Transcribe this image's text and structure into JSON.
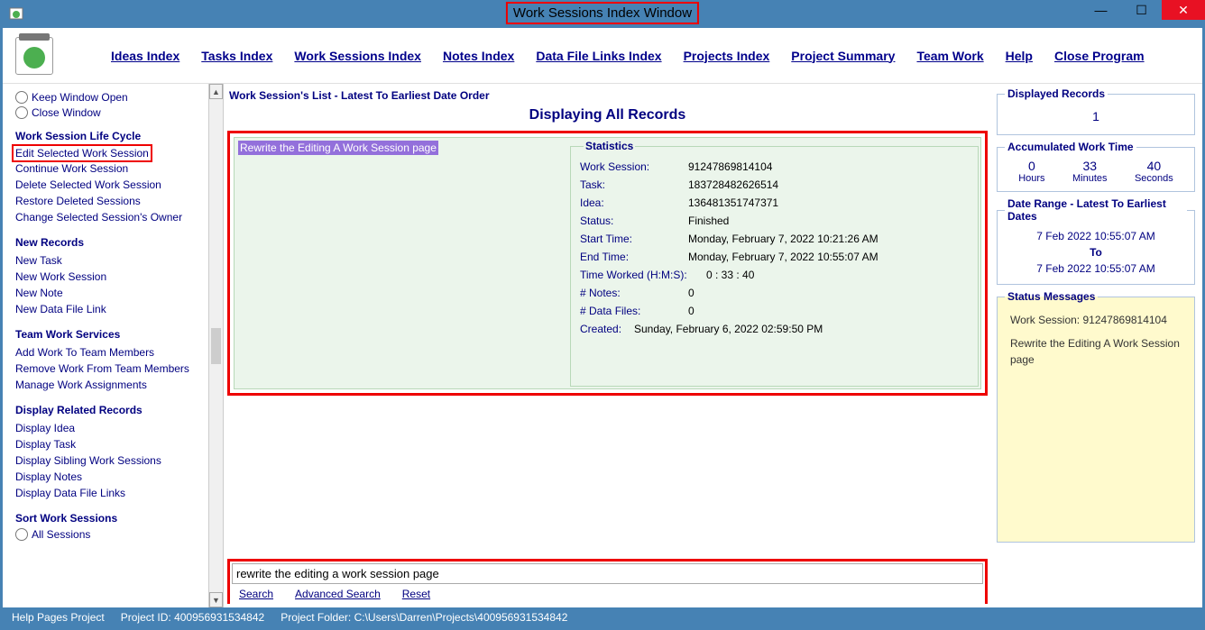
{
  "title": "Work Sessions Index Window",
  "menu": {
    "ideas": "Ideas Index",
    "tasks": "Tasks Index",
    "work_sessions": "Work Sessions Index",
    "notes": "Notes Index",
    "data_links": "Data File Links Index",
    "projects": "Projects Index",
    "summary": "Project Summary",
    "team": "Team Work",
    "help": "Help",
    "close": "Close Program"
  },
  "sidebar": {
    "keep_open": "Keep Window Open",
    "close_window": "Close Window",
    "lifecycle_title": "Work Session Life Cycle",
    "lifecycle": {
      "edit": "Edit Selected Work Session",
      "continue": "Continue Work Session",
      "delete": "Delete Selected Work Session",
      "restore": "Restore Deleted Sessions",
      "change_owner": "Change Selected Session's Owner"
    },
    "new_title": "New Records",
    "newrec": {
      "task": "New Task",
      "work": "New Work Session",
      "note": "New Note",
      "datalink": "New Data File Link"
    },
    "team_title": "Team Work Services",
    "team": {
      "add": "Add Work To Team Members",
      "remove": "Remove Work From Team Members",
      "manage": "Manage Work Assignments"
    },
    "related_title": "Display Related Records",
    "related": {
      "idea": "Display Idea",
      "task": "Display Task",
      "siblings": "Display Sibling Work Sessions",
      "notes": "Display Notes",
      "datalinks": "Display Data File Links"
    },
    "sort_title": "Sort Work Sessions",
    "all_sessions": "All Sessions"
  },
  "center": {
    "header": "Work Session's List - Latest To Earliest Date Order",
    "display_all": "Displaying All Records",
    "session_title": "Rewrite the Editing A Work Session page",
    "stats_legend": "Statistics",
    "stats": {
      "ws_label": "Work Session:",
      "ws_val": "91247869814104",
      "task_label": "Task:",
      "task_val": "183728482626514",
      "idea_label": "Idea:",
      "idea_val": "136481351747371",
      "status_label": "Status:",
      "status_val": "Finished",
      "start_label": "Start Time:",
      "start_val": "Monday, February 7, 2022   10:21:26 AM",
      "end_label": "End Time:",
      "end_val": "Monday, February 7, 2022   10:55:07 AM",
      "worked_label": "Time Worked (H:M:S):",
      "worked_val": "0  : 33  : 40",
      "notes_label": "# Notes:",
      "notes_val": "0",
      "files_label": "# Data Files:",
      "files_val": "0",
      "created_label": "Created:",
      "created_val": "Sunday, February 6, 2022   02:59:50 PM"
    },
    "search_value": "rewrite the editing a work session page",
    "search": "Search",
    "adv_search": "Advanced Search",
    "reset": "Reset"
  },
  "right": {
    "displayed_legend": "Displayed Records",
    "displayed_val": "1",
    "accum_legend": "Accumulated Work Time",
    "hours": "0",
    "hours_lbl": "Hours",
    "mins": "33",
    "mins_lbl": "Minutes",
    "secs": "40",
    "secs_lbl": "Seconds",
    "range_legend": "Date Range - Latest To Earliest Dates",
    "date1": "7 Feb 2022  10:55:07 AM",
    "to": "To",
    "date2": "7 Feb 2022  10:55:07 AM",
    "status_legend": "Status Messages",
    "status_line1": "Work Session: 91247869814104",
    "status_line2": "Rewrite the Editing A Work Session page"
  },
  "statusbar": {
    "project_name": "Help Pages Project",
    "project_id": "Project ID:  400956931534842",
    "project_folder": "Project Folder:  C:\\Users\\Darren\\Projects\\400956931534842"
  }
}
